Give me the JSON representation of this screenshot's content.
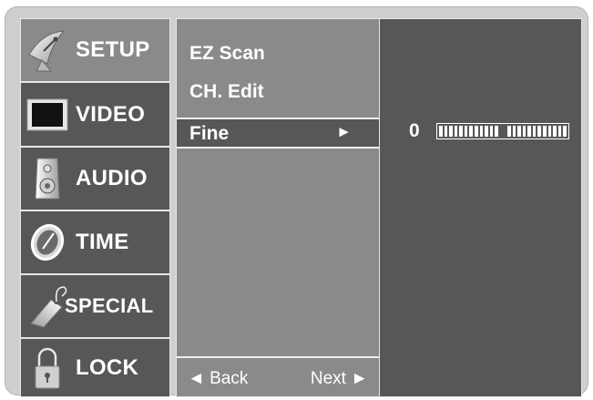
{
  "menu": {
    "items": [
      {
        "label": "SETUP",
        "icon": "satellite-dish-icon"
      },
      {
        "label": "VIDEO",
        "icon": "monitor-icon"
      },
      {
        "label": "AUDIO",
        "icon": "speaker-icon"
      },
      {
        "label": "TIME",
        "icon": "clock-icon"
      },
      {
        "label": "SPECIAL",
        "icon": "tag-icon"
      },
      {
        "label": "LOCK",
        "icon": "padlock-icon"
      }
    ],
    "selected": "SETUP"
  },
  "submenu": {
    "items": [
      {
        "label": "EZ Scan"
      },
      {
        "label": "CH. Edit"
      },
      {
        "label": "Fine",
        "arrow": "►"
      }
    ],
    "selected": "Fine"
  },
  "footer": {
    "back_label": "◄ Back",
    "next_label": "Next ►"
  },
  "fine_adjust": {
    "value": "0"
  },
  "colors": {
    "frame": "#cfcfcf",
    "dark_panel": "#575757",
    "light_panel": "#8a8a8a",
    "text": "#ffffff"
  }
}
